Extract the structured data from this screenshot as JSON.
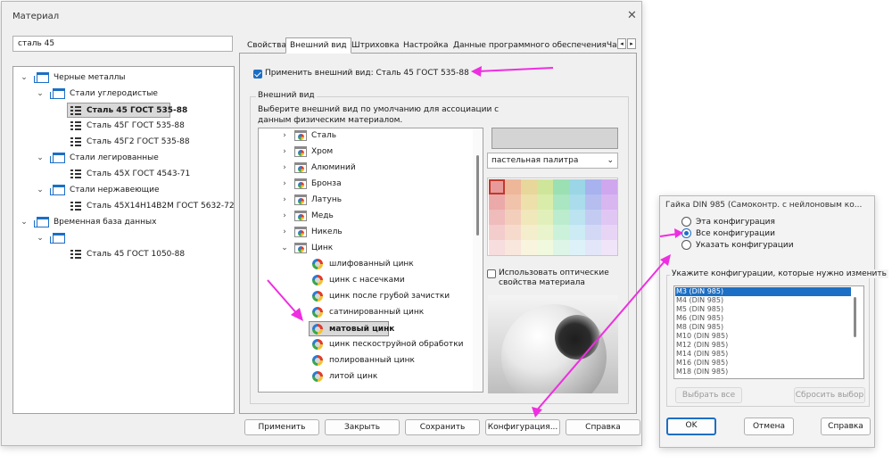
{
  "material_dialog": {
    "title": "Материал",
    "search_value": "сталь 45",
    "tree": [
      {
        "label": "Черные металлы",
        "kind": "folder",
        "expanded": true
      },
      {
        "label": "Стали углеродистые",
        "kind": "folder",
        "expanded": true
      },
      {
        "label": "Сталь 45 ГОСТ 535-88",
        "kind": "material",
        "selected": true
      },
      {
        "label": "Сталь 45Г ГОСТ 535-88",
        "kind": "material"
      },
      {
        "label": "Сталь 45Г2 ГОСТ 535-88",
        "kind": "material"
      },
      {
        "label": "Стали легированные",
        "kind": "folder",
        "expanded": true
      },
      {
        "label": "Сталь 45Х ГОСТ 4543-71",
        "kind": "material"
      },
      {
        "label": "Стали нержавеющие",
        "kind": "folder",
        "expanded": true
      },
      {
        "label": "Сталь 45Х14Н14В2М ГОСТ 5632-72",
        "kind": "material"
      },
      {
        "label": "Временная база данных",
        "kind": "folder",
        "expanded": true
      },
      {
        "label": "",
        "kind": "folder",
        "expanded": true
      },
      {
        "label": "Сталь 45 ГОСТ 1050-88",
        "kind": "material"
      }
    ],
    "tabs": [
      "Свойства",
      "Внешний вид",
      "Штриховка",
      "Настройка",
      "Данные программного обеспечения",
      "Ча"
    ],
    "active_tab": "Внешний вид",
    "apply_appearance_label": "Применить внешний вид: Сталь 45 ГОСТ 535-88",
    "apply_appearance_checked": true,
    "appearance_group_title": "Внешний вид",
    "appearance_desc": "Выберите внешний вид по умолчанию для ассоциации с данным физическим материалом.",
    "appearance_tree": [
      {
        "label": "Сталь",
        "kind": "folder",
        "expanded": false
      },
      {
        "label": "Хром",
        "kind": "folder",
        "expanded": false
      },
      {
        "label": "Алюминий",
        "kind": "folder",
        "expanded": false
      },
      {
        "label": "Бронза",
        "kind": "folder",
        "expanded": false
      },
      {
        "label": "Латунь",
        "kind": "folder",
        "expanded": false
      },
      {
        "label": "Медь",
        "kind": "folder",
        "expanded": false
      },
      {
        "label": "Никель",
        "kind": "folder",
        "expanded": false
      },
      {
        "label": "Цинк",
        "kind": "folder",
        "expanded": true
      },
      {
        "label": "шлифованный цинк",
        "kind": "item"
      },
      {
        "label": "цинк с насечками",
        "kind": "item"
      },
      {
        "label": "цинк после грубой зачистки",
        "kind": "item"
      },
      {
        "label": "сатинированный цинк",
        "kind": "item"
      },
      {
        "label": "матовый цинк",
        "kind": "item",
        "selected": true
      },
      {
        "label": "цинк пескоструйной обработки",
        "kind": "item"
      },
      {
        "label": "полированный цинк",
        "kind": "item"
      },
      {
        "label": "литой цинк",
        "kind": "item"
      }
    ],
    "palette_select": "пастельная палитра",
    "use_optical_label": "Использовать оптические свойства материала",
    "use_optical_checked": false,
    "buttons": {
      "apply": "Применить",
      "close": "Закрыть",
      "save": "Сохранить",
      "configurations": "Конфигурация...",
      "help": "Справка"
    }
  },
  "config_dialog": {
    "title": "Гайка DIN 985 (Самоконтр. с нейлоновым ко...",
    "radios": [
      {
        "label": "Эта конфигурация",
        "selected": false
      },
      {
        "label": "Все конфигурации",
        "selected": true
      },
      {
        "label": "Указать конфигурации",
        "selected": false
      }
    ],
    "list_label": "Укажите конфигурации, которые нужно изменить",
    "configs": [
      "M3 (DIN 985)",
      "M4 (DIN 985)",
      "M5 (DIN 985)",
      "M6 (DIN 985)",
      "M8 (DIN 985)",
      "M10 (DIN 985)",
      "M12 (DIN 985)",
      "M14 (DIN 985)",
      "M16 (DIN 985)",
      "M18 (DIN 985)"
    ],
    "select_all": "Выбрать все",
    "reset": "Сбросить выбор",
    "ok": "OK",
    "cancel": "Отмена",
    "help": "Справка"
  },
  "colors": {
    "accent": "#1c6fc4",
    "annotation": "#ee2ee0",
    "swatch_selected_border": "#c0392b"
  }
}
